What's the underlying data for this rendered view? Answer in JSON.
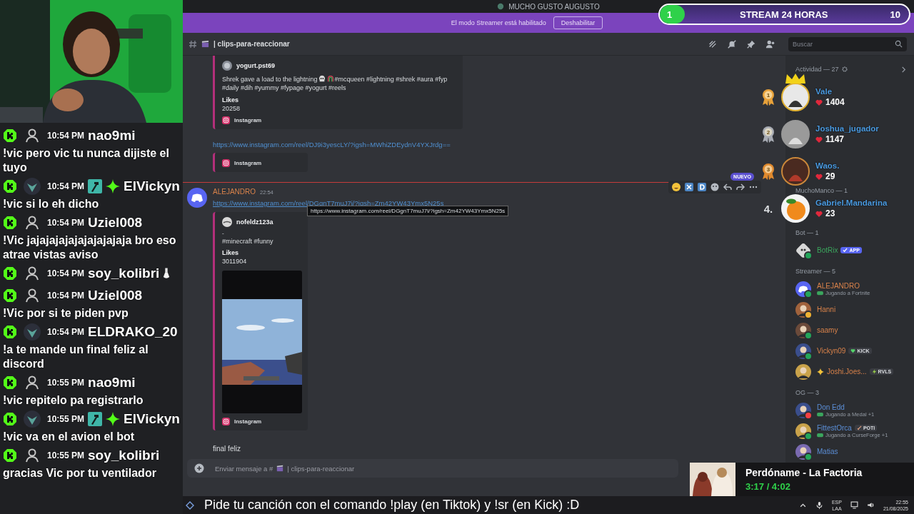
{
  "stream_chat": [
    {
      "time": "10:54 PM",
      "user": "nao9mi",
      "avatar": {
        "kind": "default"
      },
      "text": "!vic pero vic tu nunca dijiste el tuyo"
    },
    {
      "time": "10:54 PM",
      "user": "ElVickyn",
      "avatar": {
        "kind": "picture"
      },
      "roles": [
        {
          "kind": "moderator"
        },
        {
          "kind": "vip"
        }
      ],
      "text": "!vic si lo eh dicho"
    },
    {
      "time": "10:54 PM",
      "user": "Uziel008",
      "avatar": {
        "kind": "default"
      },
      "text": "!Vic jajajajajajajajajajaja bro eso atrae vistas aviso"
    },
    {
      "time": "10:54 PM",
      "user": "soy_kolibri",
      "avatar": {
        "kind": "default"
      },
      "emote": {
        "kind": "potion"
      }
    },
    {
      "time": "10:54 PM",
      "user": "Uziel008",
      "avatar": {
        "kind": "default"
      },
      "text": "!Vic por si te piden pvp"
    },
    {
      "time": "10:54 PM",
      "user": "ELDRAKO_20",
      "avatar": {
        "kind": "picture"
      },
      "text": "!a te mande un final feliz al discord"
    },
    {
      "time": "10:55 PM",
      "user": "nao9mi",
      "avatar": {
        "kind": "default"
      },
      "text": "!vic repitelo pa registrarlo"
    },
    {
      "time": "10:55 PM",
      "user": "ElVickyn",
      "avatar": {
        "kind": "picture"
      },
      "roles": [
        {
          "kind": "moderator"
        },
        {
          "kind": "vip"
        }
      ],
      "text": "!vic va en el avion el bot"
    },
    {
      "time": "10:55 PM",
      "user": "soy_kolibri",
      "avatar": {
        "kind": "default"
      },
      "text": "gracias Vic por tu ventilador"
    }
  ],
  "titlebar": {
    "title": "MUCHO GUSTO AUGUSTO"
  },
  "streamer_banner": {
    "text": "El modo Streamer está habilitado",
    "button": "Deshabilitar"
  },
  "stream_goal": {
    "current": "1",
    "title": "STREAM 24 HORAS",
    "target": "10",
    "level": 0.1
  },
  "channel": {
    "name": "| clips-para-reaccionar"
  },
  "search": {
    "placeholder": "Buscar"
  },
  "chat": {
    "first_embed": {
      "author": "yogurt.pst69",
      "description": [
        "Shrek gave a load to the lightning",
        "#mcqueen #lightning #shrek #aura #fyp",
        "#daily #dih #yummy #fypage #yogurt #reels"
      ],
      "field_name": "Likes",
      "field_value": "20258",
      "footer": "Instagram"
    },
    "first_link": "https://www.instagram.com/reel/DJ9i3yescLY/?igsh=MWhiZDEydnV4YXJrdg==",
    "first_link_embed": {
      "footer": "Instagram"
    },
    "new_divider": {
      "label": "NUEVO"
    },
    "message": {
      "author": "ALEJANDRO",
      "time": "22:54",
      "link": "https://www.instagram.com/reel/DGgnT7muJ7i/?igsh=Zm42YW43Ymx5N25s",
      "tooltip": "https://www.instagram.com/reel/DGgnT7muJ7i/?igsh=Zm42YW43Ymx5N25s",
      "embed": {
        "author": "nofeldz123a",
        "title": "-",
        "description": "#minecraft #funny",
        "field_name": "Likes",
        "field_value": "3011904",
        "media": {
          "kind": "picture"
        },
        "footer": "Instagram"
      },
      "text": "final feliz"
    },
    "composer": {
      "placeholder": "Enviar mensaje a #",
      "placeholder_channel": "| clips-para-reaccionar"
    }
  },
  "members": {
    "activity_header": "Actividad — 27",
    "groups": [
      {
        "title": "MuchoManco — 1"
      },
      {
        "title": "Bot — 1",
        "color": "#3ba55d",
        "members": [
          {
            "name": "BotRix",
            "tag": {
              "label": "APP",
              "kind": "app"
            },
            "avatar": {
              "kind": "bot"
            },
            "status": {
              "color": "#23a55a"
            }
          }
        ]
      },
      {
        "title": "Streamer — 5",
        "color": "#d9824a",
        "members": [
          {
            "name": "ALEJANDRO",
            "activity": "Jugando a Fortnite",
            "avatar": {
              "kind": "discord"
            },
            "status": {
              "color": "#23a55a"
            }
          },
          {
            "name": "Hanni",
            "avatar": {
              "kind": "person"
            },
            "status": {
              "color": "#f0b232"
            }
          },
          {
            "name": "saamy",
            "avatar": {
              "kind": "person"
            },
            "status": {
              "color": "#23a55a"
            }
          },
          {
            "name": "Vickyn09",
            "tag": {
              "label": "KICK",
              "kind": "heart"
            },
            "avatar": {
              "kind": "person"
            },
            "status": {
              "color": "#23a55a"
            }
          },
          {
            "name": "Joshi.Joes...",
            "prefix": {
              "kind": "sparkle"
            },
            "tag": {
              "label": "RVLS",
              "kind": "bolt"
            },
            "avatar": {
              "kind": "person"
            }
          }
        ]
      },
      {
        "title": "OG — 3",
        "color": "#5b8ed6",
        "members": [
          {
            "name": "Don Edd",
            "activity": "Jugando a Medal +1",
            "avatar": {
              "kind": "person"
            },
            "status": {
              "color": "#f23f43"
            }
          },
          {
            "name": "FittestOrca",
            "tag": {
              "label": "POTI",
              "kind": "sword"
            },
            "activity": "Jugando a CurseForge +1",
            "avatar": {
              "kind": "person"
            },
            "status": {
              "color": "#23a55a"
            }
          },
          {
            "name": "Matias",
            "avatar": {
              "kind": "person"
            },
            "status": {
              "color": "#23a55a"
            }
          }
        ]
      }
    ]
  },
  "leaderboard": [
    {
      "rank": {
        "label": "1",
        "kind": "medal"
      },
      "name": "Vale",
      "count": "1404",
      "crown": true,
      "avatar": {
        "kind": "picture"
      }
    },
    {
      "rank": {
        "label": "2",
        "kind": "medal"
      },
      "name": "Joshua_jugador",
      "count": "1147",
      "crown": false,
      "avatar": {
        "kind": "picture"
      }
    },
    {
      "rank": {
        "label": "3",
        "kind": "medal"
      },
      "name": "Waos.",
      "count": "29",
      "crown": false,
      "avatar": {
        "kind": "picture"
      }
    },
    {
      "rank": {
        "label": "4.",
        "kind": "number"
      },
      "name": "Gabriel.Mandarina",
      "count": "23",
      "crown": false,
      "avatar": {
        "kind": "fruit"
      }
    }
  ],
  "now_playing": {
    "title": "Perdóname - La Factoria",
    "time": "3:17 / 4:02"
  },
  "taskbar": {
    "ticker": "Pide tu canción con el comando !play (en Tiktok) y !sr (en Kick) :D",
    "language": [
      "ESP",
      "LAA"
    ],
    "time": "22:55",
    "date": "21/08/2025"
  }
}
